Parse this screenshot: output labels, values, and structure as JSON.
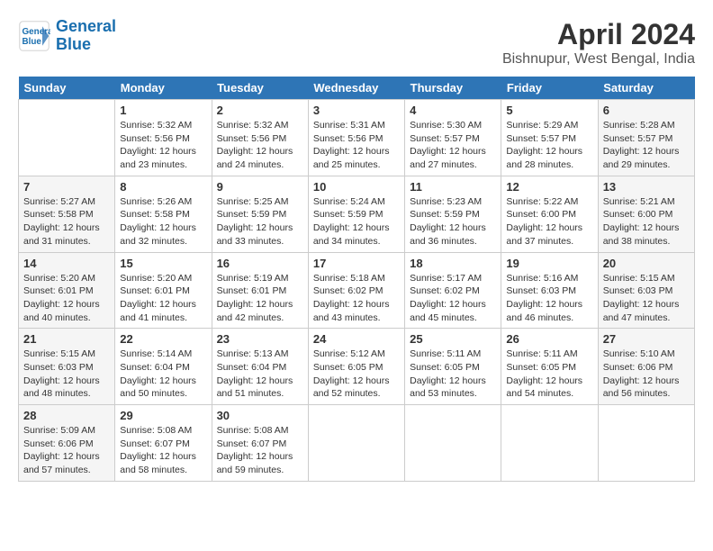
{
  "header": {
    "logo_line1": "General",
    "logo_line2": "Blue",
    "title": "April 2024",
    "subtitle": "Bishnupur, West Bengal, India"
  },
  "weekdays": [
    "Sunday",
    "Monday",
    "Tuesday",
    "Wednesday",
    "Thursday",
    "Friday",
    "Saturday"
  ],
  "weeks": [
    [
      {
        "day": "",
        "info": ""
      },
      {
        "day": "1",
        "info": "Sunrise: 5:32 AM\nSunset: 5:56 PM\nDaylight: 12 hours\nand 23 minutes."
      },
      {
        "day": "2",
        "info": "Sunrise: 5:32 AM\nSunset: 5:56 PM\nDaylight: 12 hours\nand 24 minutes."
      },
      {
        "day": "3",
        "info": "Sunrise: 5:31 AM\nSunset: 5:56 PM\nDaylight: 12 hours\nand 25 minutes."
      },
      {
        "day": "4",
        "info": "Sunrise: 5:30 AM\nSunset: 5:57 PM\nDaylight: 12 hours\nand 27 minutes."
      },
      {
        "day": "5",
        "info": "Sunrise: 5:29 AM\nSunset: 5:57 PM\nDaylight: 12 hours\nand 28 minutes."
      },
      {
        "day": "6",
        "info": "Sunrise: 5:28 AM\nSunset: 5:57 PM\nDaylight: 12 hours\nand 29 minutes."
      }
    ],
    [
      {
        "day": "7",
        "info": "Sunrise: 5:27 AM\nSunset: 5:58 PM\nDaylight: 12 hours\nand 31 minutes."
      },
      {
        "day": "8",
        "info": "Sunrise: 5:26 AM\nSunset: 5:58 PM\nDaylight: 12 hours\nand 32 minutes."
      },
      {
        "day": "9",
        "info": "Sunrise: 5:25 AM\nSunset: 5:59 PM\nDaylight: 12 hours\nand 33 minutes."
      },
      {
        "day": "10",
        "info": "Sunrise: 5:24 AM\nSunset: 5:59 PM\nDaylight: 12 hours\nand 34 minutes."
      },
      {
        "day": "11",
        "info": "Sunrise: 5:23 AM\nSunset: 5:59 PM\nDaylight: 12 hours\nand 36 minutes."
      },
      {
        "day": "12",
        "info": "Sunrise: 5:22 AM\nSunset: 6:00 PM\nDaylight: 12 hours\nand 37 minutes."
      },
      {
        "day": "13",
        "info": "Sunrise: 5:21 AM\nSunset: 6:00 PM\nDaylight: 12 hours\nand 38 minutes."
      }
    ],
    [
      {
        "day": "14",
        "info": "Sunrise: 5:20 AM\nSunset: 6:01 PM\nDaylight: 12 hours\nand 40 minutes."
      },
      {
        "day": "15",
        "info": "Sunrise: 5:20 AM\nSunset: 6:01 PM\nDaylight: 12 hours\nand 41 minutes."
      },
      {
        "day": "16",
        "info": "Sunrise: 5:19 AM\nSunset: 6:01 PM\nDaylight: 12 hours\nand 42 minutes."
      },
      {
        "day": "17",
        "info": "Sunrise: 5:18 AM\nSunset: 6:02 PM\nDaylight: 12 hours\nand 43 minutes."
      },
      {
        "day": "18",
        "info": "Sunrise: 5:17 AM\nSunset: 6:02 PM\nDaylight: 12 hours\nand 45 minutes."
      },
      {
        "day": "19",
        "info": "Sunrise: 5:16 AM\nSunset: 6:03 PM\nDaylight: 12 hours\nand 46 minutes."
      },
      {
        "day": "20",
        "info": "Sunrise: 5:15 AM\nSunset: 6:03 PM\nDaylight: 12 hours\nand 47 minutes."
      }
    ],
    [
      {
        "day": "21",
        "info": "Sunrise: 5:15 AM\nSunset: 6:03 PM\nDaylight: 12 hours\nand 48 minutes."
      },
      {
        "day": "22",
        "info": "Sunrise: 5:14 AM\nSunset: 6:04 PM\nDaylight: 12 hours\nand 50 minutes."
      },
      {
        "day": "23",
        "info": "Sunrise: 5:13 AM\nSunset: 6:04 PM\nDaylight: 12 hours\nand 51 minutes."
      },
      {
        "day": "24",
        "info": "Sunrise: 5:12 AM\nSunset: 6:05 PM\nDaylight: 12 hours\nand 52 minutes."
      },
      {
        "day": "25",
        "info": "Sunrise: 5:11 AM\nSunset: 6:05 PM\nDaylight: 12 hours\nand 53 minutes."
      },
      {
        "day": "26",
        "info": "Sunrise: 5:11 AM\nSunset: 6:05 PM\nDaylight: 12 hours\nand 54 minutes."
      },
      {
        "day": "27",
        "info": "Sunrise: 5:10 AM\nSunset: 6:06 PM\nDaylight: 12 hours\nand 56 minutes."
      }
    ],
    [
      {
        "day": "28",
        "info": "Sunrise: 5:09 AM\nSunset: 6:06 PM\nDaylight: 12 hours\nand 57 minutes."
      },
      {
        "day": "29",
        "info": "Sunrise: 5:08 AM\nSunset: 6:07 PM\nDaylight: 12 hours\nand 58 minutes."
      },
      {
        "day": "30",
        "info": "Sunrise: 5:08 AM\nSunset: 6:07 PM\nDaylight: 12 hours\nand 59 minutes."
      },
      {
        "day": "",
        "info": ""
      },
      {
        "day": "",
        "info": ""
      },
      {
        "day": "",
        "info": ""
      },
      {
        "day": "",
        "info": ""
      }
    ]
  ]
}
